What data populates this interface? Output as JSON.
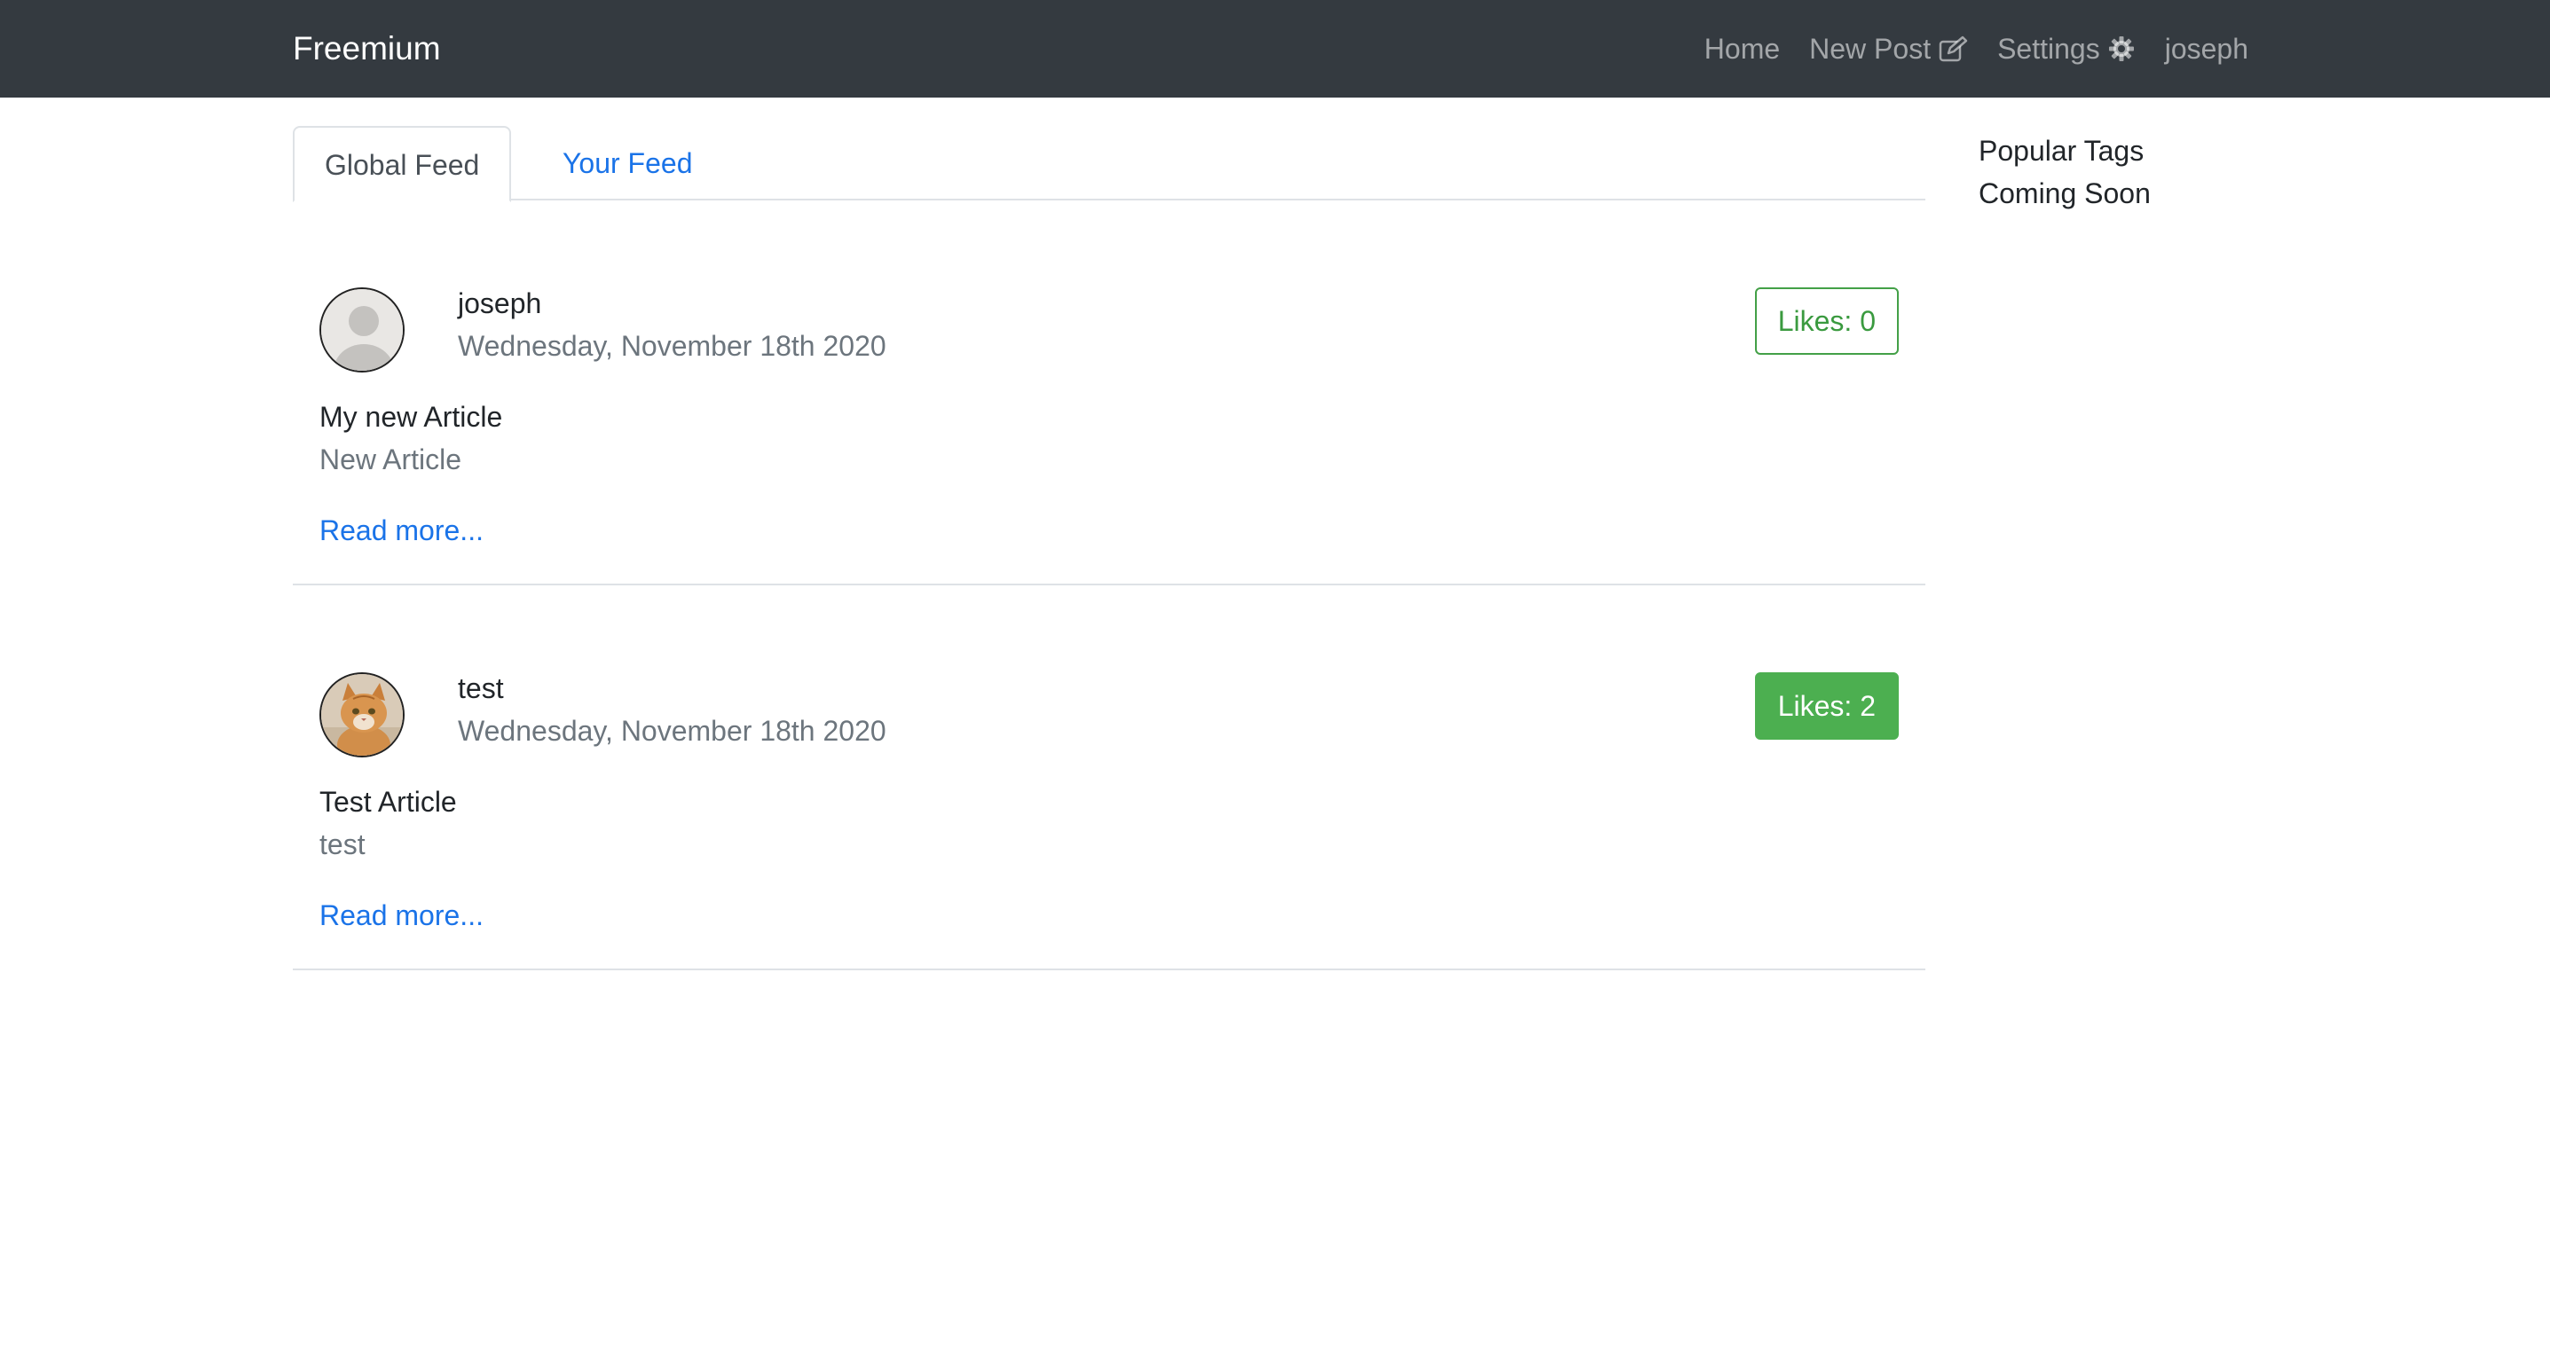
{
  "navbar": {
    "brand": "Freemium",
    "links": {
      "home": "Home",
      "new_post": "New Post",
      "settings": "Settings",
      "user": "joseph"
    }
  },
  "tabs": {
    "global": "Global Feed",
    "yours": "Your Feed"
  },
  "articles": [
    {
      "author": "joseph",
      "date": "Wednesday, November 18th 2020",
      "likes": "Likes: 0",
      "title": "My new Article",
      "description": "New Article",
      "read_more": "Read more..."
    },
    {
      "author": "test",
      "date": "Wednesday, November 18th 2020",
      "likes": "Likes: 2",
      "title": "Test Article",
      "description": "test",
      "read_more": "Read more..."
    }
  ],
  "sidebar": {
    "heading": "Popular Tags",
    "content": "Coming Soon"
  },
  "colors": {
    "navbar": "#343a40",
    "link": "#1a73e8",
    "success": "#4caf50"
  },
  "icons": {
    "new_post": "edit-icon",
    "settings": "gear-icon",
    "avatar_default": "default-avatar-icon",
    "avatar_cat": "cat-avatar"
  }
}
